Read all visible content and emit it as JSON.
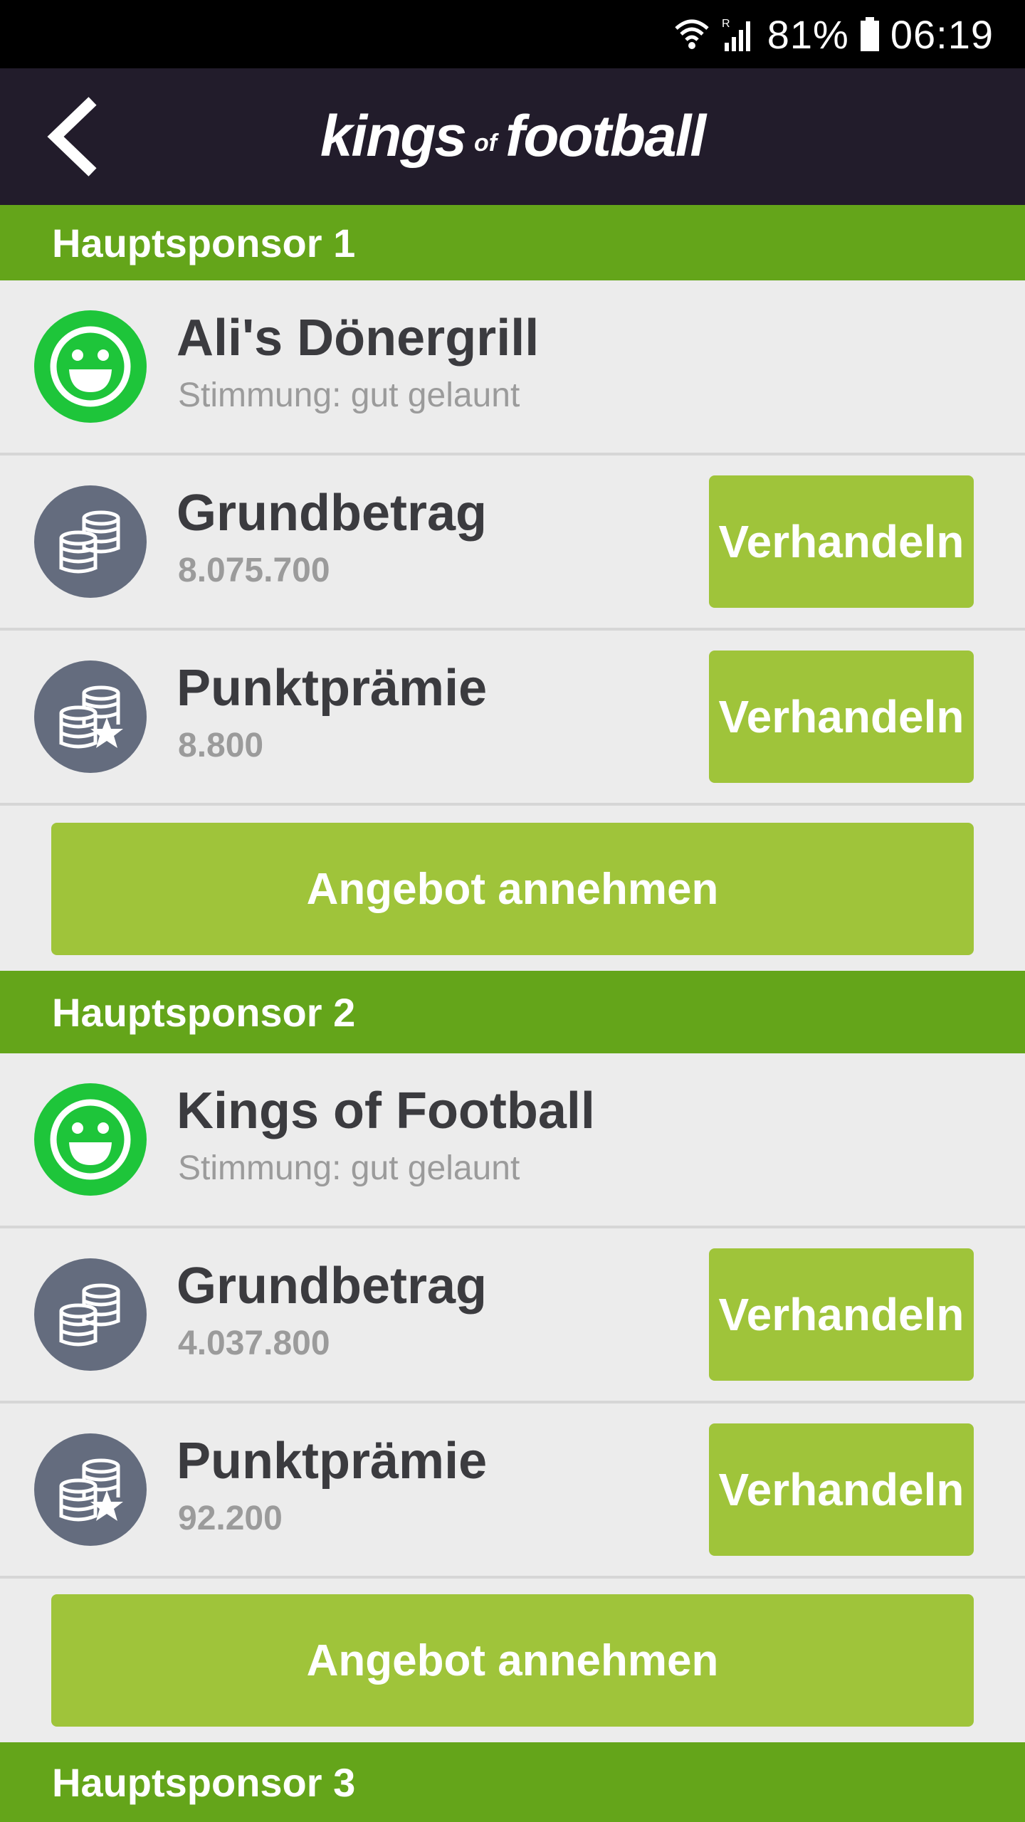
{
  "status": {
    "battery": "81%",
    "time": "06:19"
  },
  "app": {
    "logo_main1": "kings",
    "logo_of": "of",
    "logo_main2": "football"
  },
  "sponsors": [
    {
      "header": "Hauptsponsor 1",
      "name": "Ali's Dönergrill",
      "mood": "Stimmung: gut gelaunt",
      "base_label": "Grundbetrag",
      "base_value": "8.075.700",
      "bonus_label": "Punktprämie",
      "bonus_value": "8.800",
      "negotiate": "Verhandeln",
      "accept": "Angebot annehmen"
    },
    {
      "header": "Hauptsponsor 2",
      "name": "Kings of Football",
      "mood": "Stimmung: gut gelaunt",
      "base_label": "Grundbetrag",
      "base_value": "4.037.800",
      "bonus_label": "Punktprämie",
      "bonus_value": "92.200",
      "negotiate": "Verhandeln",
      "accept": "Angebot annehmen"
    },
    {
      "header": "Hauptsponsor 3"
    }
  ],
  "colors": {
    "section_header": "#64a51a",
    "button": "#9fc43a",
    "mood_good": "#1ec53a",
    "coin_icon_bg": "#646c7e",
    "appbar": "#221c2b"
  }
}
